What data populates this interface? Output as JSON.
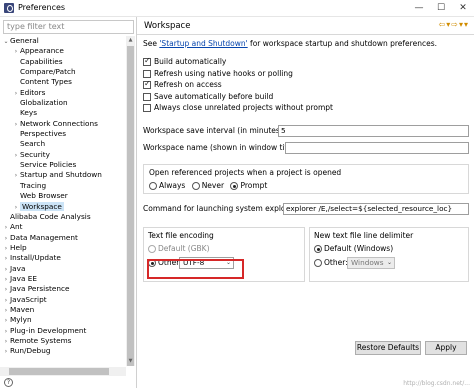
{
  "window": {
    "title": "Preferences",
    "minimize": "—",
    "maximize": "☐",
    "close": "✕"
  },
  "filter": {
    "placeholder": "type filter text"
  },
  "tree": [
    {
      "label": "General",
      "expanded": true
    },
    {
      "label": "Appearance",
      "arrow": "›"
    },
    {
      "label": "Capabilities"
    },
    {
      "label": "Compare/Patch"
    },
    {
      "label": "Content Types"
    },
    {
      "label": "Editors",
      "arrow": "›"
    },
    {
      "label": "Globalization"
    },
    {
      "label": "Keys"
    },
    {
      "label": "Network Connections",
      "arrow": "›"
    },
    {
      "label": "Perspectives"
    },
    {
      "label": "Search"
    },
    {
      "label": "Security",
      "arrow": "›"
    },
    {
      "label": "Service Policies"
    },
    {
      "label": "Startup and Shutdown",
      "arrow": "›"
    },
    {
      "label": "Tracing"
    },
    {
      "label": "Web Browser"
    },
    {
      "label": "Workspace",
      "arrow": "›",
      "selected": true
    },
    {
      "label": "Alibaba Code Analysis"
    },
    {
      "label": "Ant",
      "arrow": "›"
    },
    {
      "label": "Data Management",
      "arrow": "›"
    },
    {
      "label": "Help",
      "arrow": "›"
    },
    {
      "label": "Install/Update",
      "arrow": "›"
    },
    {
      "label": "Java",
      "arrow": "›"
    },
    {
      "label": "Java EE",
      "arrow": "›"
    },
    {
      "label": "Java Persistence",
      "arrow": "›"
    },
    {
      "label": "JavaScript",
      "arrow": "›"
    },
    {
      "label": "Maven",
      "arrow": "›"
    },
    {
      "label": "Mylyn",
      "arrow": "›"
    },
    {
      "label": "Plug-in Development",
      "arrow": "›"
    },
    {
      "label": "Remote Systems",
      "arrow": "›"
    },
    {
      "label": "Run/Debug",
      "arrow": "›"
    }
  ],
  "page": {
    "title": "Workspace",
    "see_prefix": "See ",
    "see_link": "'Startup and Shutdown'",
    "see_suffix": " for workspace startup and shutdown preferences.",
    "checkboxes": [
      {
        "label": "Build automatically",
        "checked": true
      },
      {
        "label": "Refresh using native hooks or polling",
        "checked": false
      },
      {
        "label": "Refresh on access",
        "checked": true
      },
      {
        "label": "Save automatically before build",
        "checked": false
      },
      {
        "label": "Always close unrelated projects without prompt",
        "checked": false
      }
    ],
    "save_interval_label": "Workspace save interval (in minutes):",
    "save_interval_value": "5",
    "workspace_name_label": "Workspace name (shown in window title):",
    "workspace_name_value": "",
    "open_ref_label": "Open referenced projects when a project is opened",
    "open_ref_options": [
      "Always",
      "Never",
      "Prompt"
    ],
    "open_ref_selected": "Prompt",
    "explorer_label": "Command for launching system explorer:",
    "explorer_value": "explorer /E,/select=${selected_resource_loc}",
    "encoding": {
      "title": "Text file encoding",
      "default_label": "Default (GBK)",
      "other_label": "Other:",
      "other_value": "UTF-8",
      "selected": "Other"
    },
    "delimiter": {
      "title": "New text file line delimiter",
      "default_label": "Default (Windows)",
      "other_label": "Other:",
      "other_value": "Windows",
      "selected": "Default"
    },
    "restore_defaults": "Restore Defaults",
    "apply": "Apply"
  },
  "watermark": "http://blog.csdn.net/..."
}
